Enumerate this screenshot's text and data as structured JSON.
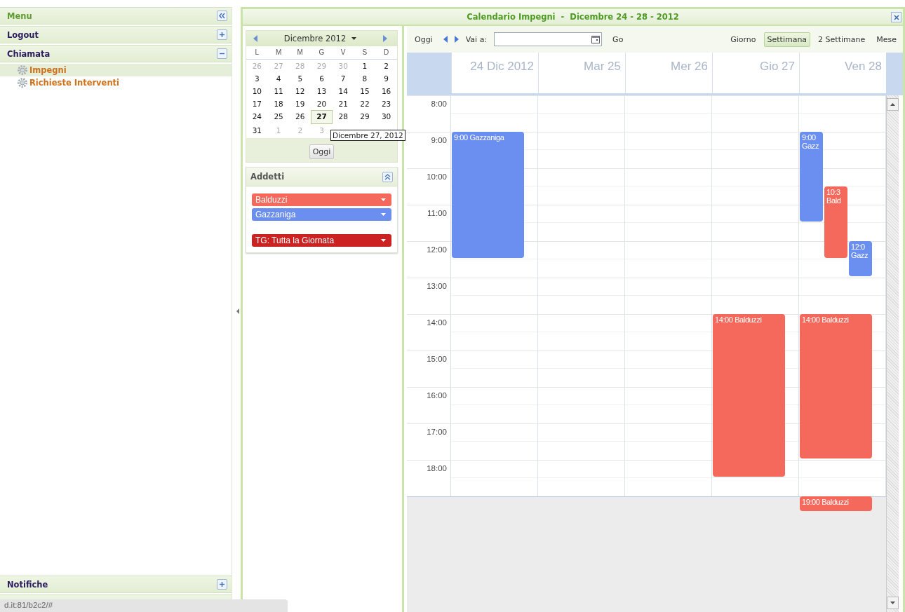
{
  "sidebar": {
    "sections": [
      {
        "title": "Menu",
        "kind": "title"
      },
      {
        "title": "Logout",
        "kind": "section",
        "expanded": false
      },
      {
        "title": "Chiamata",
        "kind": "section",
        "expanded": true,
        "items": [
          {
            "label": "Impegni",
            "selected": true
          },
          {
            "label": "Richieste Interventi",
            "selected": false
          }
        ]
      }
    ],
    "bottom_sections": [
      {
        "title": "Notifiche",
        "expanded": false
      }
    ]
  },
  "panel": {
    "title": "Calendario Impegni  -  Dicembre 24 - 28 - 2012"
  },
  "mini_calendar": {
    "month": "Dicembre 2012",
    "weekdays": [
      "L",
      "M",
      "M",
      "G",
      "V",
      "S",
      "D"
    ],
    "weeks": [
      [
        {
          "d": "26",
          "outside": true,
          "today": false
        },
        {
          "d": "27",
          "outside": true,
          "today": false
        },
        {
          "d": "28",
          "outside": true,
          "today": false
        },
        {
          "d": "29",
          "outside": true,
          "today": false
        },
        {
          "d": "30",
          "outside": true,
          "today": false
        },
        {
          "d": "1",
          "outside": false,
          "today": false
        },
        {
          "d": "2",
          "outside": false,
          "today": false
        }
      ],
      [
        {
          "d": "3",
          "outside": false,
          "today": false
        },
        {
          "d": "4",
          "outside": false,
          "today": false
        },
        {
          "d": "5",
          "outside": false,
          "today": false
        },
        {
          "d": "6",
          "outside": false,
          "today": false
        },
        {
          "d": "7",
          "outside": false,
          "today": false
        },
        {
          "d": "8",
          "outside": false,
          "today": false
        },
        {
          "d": "9",
          "outside": false,
          "today": false
        }
      ],
      [
        {
          "d": "10",
          "outside": false,
          "today": false
        },
        {
          "d": "11",
          "outside": false,
          "today": false
        },
        {
          "d": "12",
          "outside": false,
          "today": false
        },
        {
          "d": "13",
          "outside": false,
          "today": false
        },
        {
          "d": "14",
          "outside": false,
          "today": false
        },
        {
          "d": "15",
          "outside": false,
          "today": false
        },
        {
          "d": "16",
          "outside": false,
          "today": false
        }
      ],
      [
        {
          "d": "17",
          "outside": false,
          "today": false
        },
        {
          "d": "18",
          "outside": false,
          "today": false
        },
        {
          "d": "19",
          "outside": false,
          "today": false
        },
        {
          "d": "20",
          "outside": false,
          "today": false
        },
        {
          "d": "21",
          "outside": false,
          "today": false
        },
        {
          "d": "22",
          "outside": false,
          "today": false
        },
        {
          "d": "23",
          "outside": false,
          "today": false
        }
      ],
      [
        {
          "d": "24",
          "outside": false,
          "today": false
        },
        {
          "d": "25",
          "outside": false,
          "today": false
        },
        {
          "d": "26",
          "outside": false,
          "today": false
        },
        {
          "d": "27",
          "outside": false,
          "today": true
        },
        {
          "d": "28",
          "outside": false,
          "today": false
        },
        {
          "d": "29",
          "outside": false,
          "today": false
        },
        {
          "d": "30",
          "outside": false,
          "today": false
        }
      ],
      [
        {
          "d": "31",
          "outside": false,
          "today": false
        },
        {
          "d": "1",
          "outside": true,
          "today": false
        },
        {
          "d": "2",
          "outside": true,
          "today": false
        },
        {
          "d": "3",
          "outside": true,
          "today": false
        }
      ]
    ],
    "tooltip": "Dicembre 27, 2012",
    "today_button": "Oggi"
  },
  "addetti": {
    "title": "Addetti",
    "expanded": true,
    "items": [
      {
        "name": "Balduzzi",
        "color": "#f4695b",
        "kind": "person"
      },
      {
        "name": "Gazzaniga",
        "color": "#6b8ff0",
        "kind": "person"
      },
      {
        "name": "TG: Tutta la Giornata",
        "color": "#cc2222",
        "kind": "allday"
      }
    ]
  },
  "toolbar": {
    "today": "Oggi",
    "goto_label": "Vai a:",
    "go": "Go",
    "views": [
      {
        "label": "Giorno",
        "selected": false
      },
      {
        "label": "Settimana",
        "selected": true
      },
      {
        "label": "2 Settimane",
        "selected": false
      },
      {
        "label": "Mese",
        "selected": false
      }
    ]
  },
  "calendar": {
    "hours": [
      "8:00",
      "9:00",
      "10:00",
      "11:00",
      "12:00",
      "13:00",
      "14:00",
      "15:00",
      "16:00",
      "17:00",
      "18:00"
    ],
    "days": [
      {
        "label": "24 Dic 2012",
        "events": [
          {
            "label": "9:00 Gazzaniga",
            "color": "#6b8ff0"
          }
        ]
      },
      {
        "label": "Mar 25"
      },
      {
        "label": "Mer 26"
      },
      {
        "label": "Gio 27",
        "events": [
          {
            "label": "14:00 Balduzzi",
            "color": "#f4695b"
          }
        ]
      },
      {
        "label": "Ven 28",
        "events": [
          {
            "label": "9:00 Gazz",
            "color": "#6b8ff0"
          },
          {
            "label": "10:3 Bald",
            "color": "#f4695b"
          },
          {
            "label": "12:0 Gazz",
            "color": "#6b8ff0"
          },
          {
            "label": "14:00 Balduzzi",
            "color": "#f4695b"
          },
          {
            "label": "19:00 Balduzzi",
            "color": "#f4695b"
          }
        ]
      }
    ]
  },
  "status_bar": {
    "url": "d.it:81/b2c2/#"
  }
}
